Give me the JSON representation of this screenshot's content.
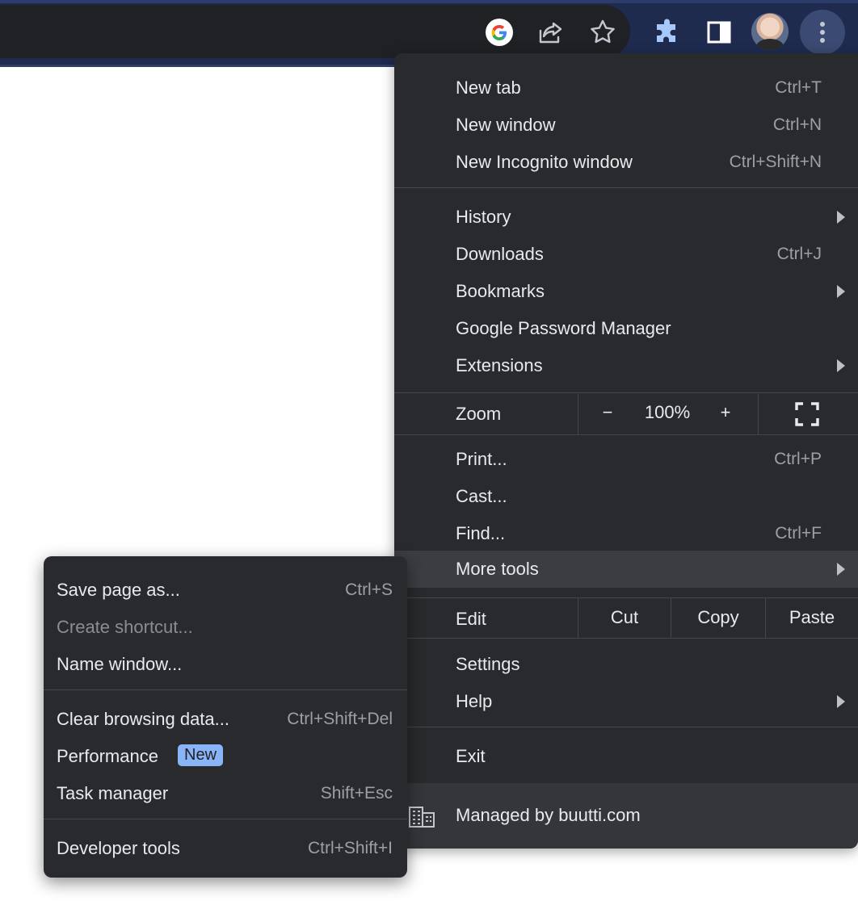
{
  "main_menu": {
    "group1": [
      {
        "label": "New tab",
        "shortcut": "Ctrl+T"
      },
      {
        "label": "New window",
        "shortcut": "Ctrl+N"
      },
      {
        "label": "New Incognito window",
        "shortcut": "Ctrl+Shift+N"
      }
    ],
    "group2": [
      {
        "label": "History",
        "shortcut": ""
      },
      {
        "label": "Downloads",
        "shortcut": "Ctrl+J"
      },
      {
        "label": "Bookmarks",
        "shortcut": ""
      },
      {
        "label": "Google Password Manager",
        "shortcut": ""
      },
      {
        "label": "Extensions",
        "shortcut": ""
      }
    ],
    "zoom": {
      "label": "Zoom",
      "minus": "−",
      "value": "100%",
      "plus": "+"
    },
    "group3": [
      {
        "label": "Print...",
        "shortcut": "Ctrl+P"
      },
      {
        "label": "Cast...",
        "shortcut": ""
      },
      {
        "label": "Find...",
        "shortcut": "Ctrl+F"
      },
      {
        "label": "More tools",
        "shortcut": ""
      }
    ],
    "edit": {
      "label": "Edit",
      "cut": "Cut",
      "copy": "Copy",
      "paste": "Paste"
    },
    "group4": [
      {
        "label": "Settings"
      },
      {
        "label": "Help"
      }
    ],
    "exit": {
      "label": "Exit"
    },
    "managed": {
      "label": "Managed by buutti.com"
    }
  },
  "more_tools_submenu": {
    "group1": [
      {
        "label": "Save page as...",
        "shortcut": "Ctrl+S"
      },
      {
        "label": "Create shortcut...",
        "shortcut": ""
      },
      {
        "label": "Name window...",
        "shortcut": ""
      }
    ],
    "group2": [
      {
        "label": "Clear browsing data...",
        "shortcut": "Ctrl+Shift+Del"
      },
      {
        "label": "Performance",
        "shortcut": ""
      },
      {
        "label": "Task manager",
        "shortcut": "Shift+Esc"
      }
    ],
    "performance_badge": "New",
    "group3": [
      {
        "label": "Developer tools",
        "shortcut": "Ctrl+Shift+I"
      }
    ]
  },
  "toolbar": {
    "icons": [
      "google-icon",
      "share-icon",
      "bookmark-star-icon",
      "extensions-puzzle-icon",
      "side-panel-icon",
      "profile-avatar",
      "kebab-menu-icon"
    ]
  },
  "colors": {
    "menu_bg": "#292a2d",
    "menu_text": "#e8eaed",
    "shortcut_text": "#9aa0a6",
    "highlight_bg": "#3c3d41",
    "badge_bg": "#8ab4f8",
    "toolbar_bg": "#1e2b4f"
  }
}
